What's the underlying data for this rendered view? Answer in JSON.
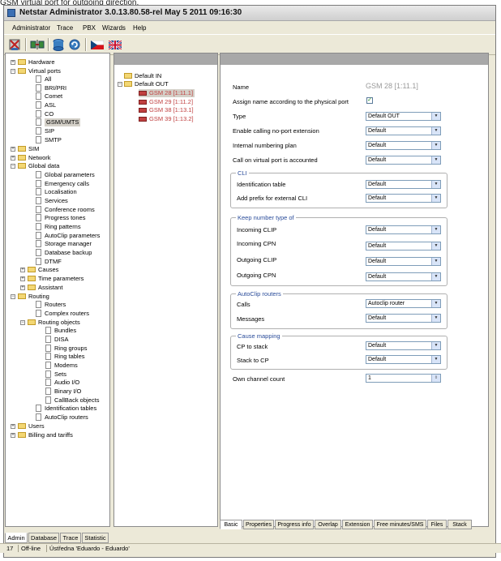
{
  "doc_text": {
    "pre": "GSM ",
    "u1": "virtual",
    " mid": " port ",
    "u2": "for outgoing direction."
  },
  "window": {
    "title": "Netstar Administrator 3.0.13.80.58-rel May  5 2011 09:16:30"
  },
  "menu": [
    "Administrator",
    "Trace",
    "PBX",
    "Wizards",
    "Help"
  ],
  "toolbar": {
    "icons": [
      "administrator-icon",
      "connect-icon",
      "database-icon",
      "refresh-icon",
      "czech-flag-icon",
      "uk-flag-icon"
    ]
  },
  "tree": [
    "Hardware",
    "Virtual ports",
    "All",
    "BRI/PRI",
    "Comet",
    "ASL",
    "CO",
    "GSM/UMTS",
    "SIP",
    "SMTP",
    "SIM",
    "Network",
    "Global data",
    "Global parameters",
    "Emergency calls",
    "Localisation",
    "Services",
    "Conference rooms",
    "Progress tones",
    "Ring patterns",
    "AutoClip parameters",
    "Storage manager",
    "Database backup",
    "DTMF",
    "Causes",
    "Time parameters",
    "Assistant",
    "Routing",
    "Routers",
    "Complex routers",
    "Routing objects",
    "Bundles",
    "DISA",
    "Ring groups",
    "Ring tables",
    "Modems",
    "Sets",
    "Audio I/O",
    "Binary I/O",
    "CallBack objects",
    "Identification tables",
    "AutoClip routers",
    "Users",
    "Billing and tariffs"
  ],
  "mid_tree": {
    "default_in": "Default IN",
    "default_out": "Default OUT",
    "ports": [
      "GSM 28 [1:11.1]",
      "GSM 29 [1:11.2]",
      "GSM 38 [1:13.1]",
      "GSM 39 [1:13.2]"
    ]
  },
  "props": {
    "name_label": "Name",
    "name_value": "GSM 28 [1:11.1]",
    "assign_name": "Assign name according to the physical port",
    "type": "Type",
    "type_val": "Default OUT",
    "no_port": "Enable calling no-port extension",
    "no_port_val": "Default",
    "internal_plan": "Internal numbering plan",
    "internal_plan_val": "Default",
    "accounted": "Call on virtual port is accounted",
    "accounted_val": "Default",
    "cli_title": "CLI",
    "id_table": "Identification table",
    "id_table_val": "Default",
    "add_prefix": "Add prefix for external CLI",
    "add_prefix_val": "Default",
    "knt_title": "Keep number type of",
    "in_clip": "Incoming CLIP",
    "in_clip_val": "Default",
    "in_cpn": "Incoming CPN",
    "in_cpn_val": "Default",
    "out_clip": "Outgoing CLIP",
    "out_clip_val": "Default",
    "out_cpn": "Outgoing CPN",
    "out_cpn_val": "Default",
    "ac_title": "AutoClip routers",
    "calls": "Calls",
    "calls_val": "Autoclip router",
    "messages": "Messages",
    "messages_val": "Default",
    "cm_title": "Cause mapping",
    "cp_stack": "CP to stack",
    "cp_stack_val": "Default",
    "stack_cp": "Stack to CP",
    "stack_cp_val": "Default",
    "own_channel": "Own channel count",
    "own_channel_val": "1"
  },
  "bottom_tabs": [
    "Basic",
    "Properties",
    "Progress info",
    "Overlap",
    "Extension",
    "Free minutes/SMS",
    "Files",
    "Stack"
  ],
  "left_tabs": [
    "Admin",
    "Database",
    "Trace",
    "Statistic"
  ],
  "status": {
    "num": "17",
    "mode": "Off-line",
    "pbx": "Ústředna 'Eduardo - Eduardo'"
  }
}
